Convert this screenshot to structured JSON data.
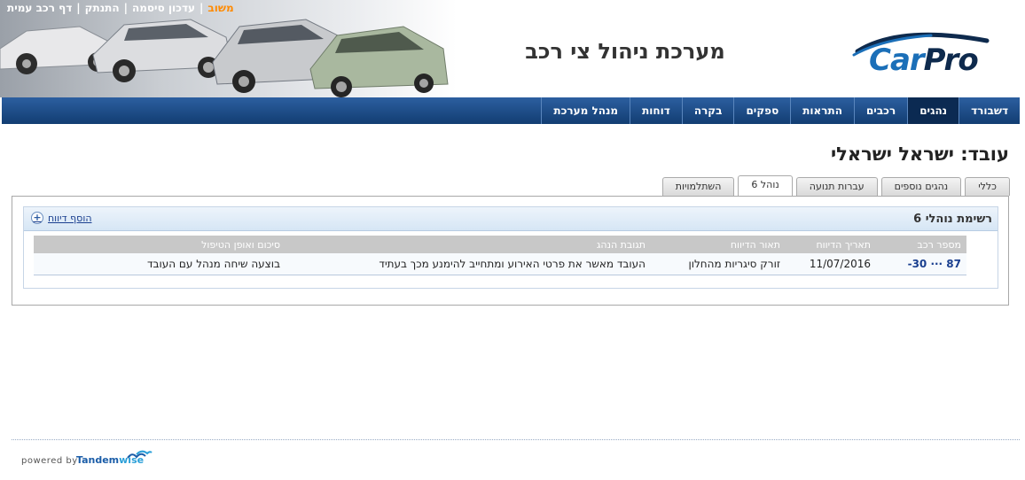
{
  "header": {
    "top_links": [
      "משוב",
      "עדכון סיסמה",
      "התנתק",
      "דף רכב עמית"
    ],
    "system_title": "מערכת ניהול צי רכב",
    "logo": {
      "car": "Car",
      "pro": "Pro"
    }
  },
  "nav": {
    "items": [
      {
        "label": "דשבורד",
        "active": false
      },
      {
        "label": "נהגים",
        "active": true
      },
      {
        "label": "רכבים",
        "active": false
      },
      {
        "label": "התראות",
        "active": false
      },
      {
        "label": "ספקים",
        "active": false
      },
      {
        "label": "בקרה",
        "active": false
      },
      {
        "label": "דוחות",
        "active": false
      },
      {
        "label": "מנהל מערכת",
        "active": false
      }
    ]
  },
  "page": {
    "title": "עובד: ישראל ישראלי"
  },
  "tabs": [
    {
      "label": "כללי",
      "active": false
    },
    {
      "label": "נהגים נוספים",
      "active": false
    },
    {
      "label": "עברות תנועה",
      "active": false
    },
    {
      "label": "נוהל 6",
      "active": true
    },
    {
      "label": "השתלמויות",
      "active": false
    }
  ],
  "panel": {
    "title": "רשימת נוהלי 6",
    "add_link": "הוסף דיווח"
  },
  "table": {
    "headers": [
      "מספר רכב",
      "תאריך הדיווח",
      "תאור הדיווח",
      "תגובת הנהג",
      "סיכום ואופן הטיפול"
    ],
    "rows": [
      [
        "87 ··· 30-",
        "11/07/2016",
        "זורק סיגריות מהחלון",
        "העובד מאשר את פרטי האירוע ומתחייב להימנע מכך בעתיד",
        "בוצעה שיחה מנהל עם העובד"
      ]
    ]
  },
  "footer": {
    "powered": "powered by",
    "brand_main": "Tandem",
    "brand_accent": "wise"
  },
  "colors": {
    "nav_bg": "#1f4f8a",
    "nav_active": "#0b2a52",
    "accent_link": "#1a3f8f",
    "hot_link": "#ff8a00"
  }
}
